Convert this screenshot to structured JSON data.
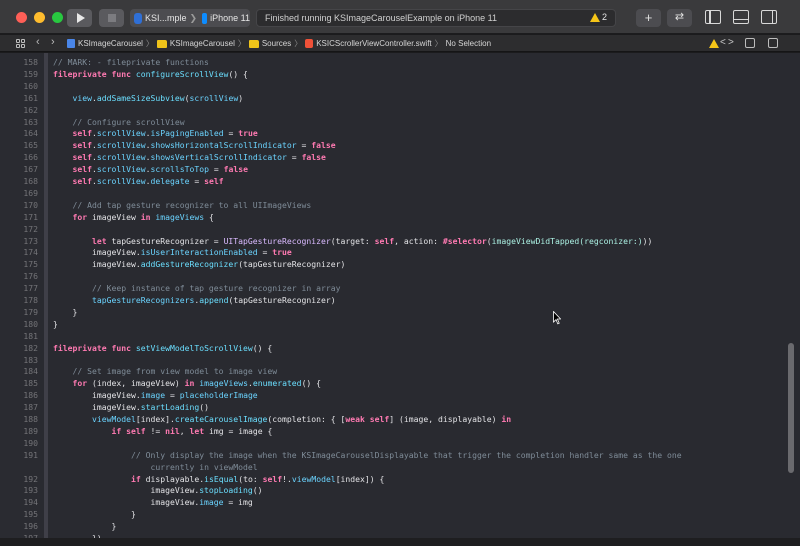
{
  "toolbar": {
    "scheme_name": "KSI...mple",
    "scheme_chevron": "❯",
    "device": "iPhone 11",
    "activity_text": "Finished running KSImageCarouselExample on iPhone 11",
    "warning_count": "2",
    "plus_label": "+",
    "swap_label": "⇄"
  },
  "jumpbar": {
    "back": "‹",
    "forward": "›",
    "crumbs": [
      "KSImageCarousel",
      "KSImageCarousel",
      "Sources",
      "KSICScrollerViewController.swift",
      "No Selection"
    ],
    "separator": "〉",
    "lt": "<",
    "gt": ">"
  },
  "colors": {
    "keyword": "#ff7ab2",
    "function": "#6bdfff",
    "type": "#dabaff",
    "comment": "#7f8c98",
    "background": "#292a30"
  },
  "editor": {
    "lines": [
      {
        "n": "158",
        "html": "<span class='cm'>// MARK: - fileprivate functions</span>"
      },
      {
        "n": "159",
        "html": "<span class='kw'>fileprivate func</span> <span class='fn'>configureScrollView</span>() {"
      },
      {
        "n": "160",
        "html": ""
      },
      {
        "n": "161",
        "html": "    <span class='prop'>view</span>.<span class='fn'>addSameSizeSubview</span>(<span class='prop'>scrollView</span>)"
      },
      {
        "n": "162",
        "html": ""
      },
      {
        "n": "163",
        "html": "    <span class='cm'>// Configure scrollView</span>"
      },
      {
        "n": "164",
        "html": "    <span class='kw'>self</span>.<span class='prop'>scrollView</span>.<span class='prop'>isPagingEnabled</span> = <span class='kw'>true</span>"
      },
      {
        "n": "165",
        "html": "    <span class='kw'>self</span>.<span class='prop'>scrollView</span>.<span class='prop'>showsHorizontalScrollIndicator</span> = <span class='kw'>false</span>"
      },
      {
        "n": "166",
        "html": "    <span class='kw'>self</span>.<span class='prop'>scrollView</span>.<span class='prop'>showsVerticalScrollIndicator</span> = <span class='kw'>false</span>"
      },
      {
        "n": "167",
        "html": "    <span class='kw'>self</span>.<span class='prop'>scrollView</span>.<span class='prop'>scrollsToTop</span> = <span class='kw'>false</span>"
      },
      {
        "n": "168",
        "html": "    <span class='kw'>self</span>.<span class='prop'>scrollView</span>.<span class='prop'>delegate</span> = <span class='kw'>self</span>"
      },
      {
        "n": "169",
        "html": ""
      },
      {
        "n": "170",
        "html": "    <span class='cm'>// Add tap gesture recognizer to all UIImageViews</span>"
      },
      {
        "n": "171",
        "html": "    <span class='kw'>for</span> imageView <span class='kw'>in</span> <span class='prop'>imageViews</span> {"
      },
      {
        "n": "172",
        "html": ""
      },
      {
        "n": "173",
        "html": "        <span class='kw'>let</span> tapGestureRecognizer = <span class='ty'>UITapGestureRecognizer</span>(target: <span class='kw'>self</span>, action: <span class='kw'>#selector</span>(<span class='ph'>imageViewDidTapped(regconizer:)</span>))"
      },
      {
        "n": "174",
        "html": "        imageView.<span class='prop'>isUserInteractionEnabled</span> = <span class='kw'>true</span>"
      },
      {
        "n": "175",
        "html": "        imageView.<span class='fn'>addGestureRecognizer</span>(tapGestureRecognizer)"
      },
      {
        "n": "176",
        "html": ""
      },
      {
        "n": "177",
        "html": "        <span class='cm'>// Keep instance of tap gesture recognizer in array</span>"
      },
      {
        "n": "178",
        "html": "        <span class='prop'>tapGestureRecognizers</span>.<span class='fn'>append</span>(tapGestureRecognizer)"
      },
      {
        "n": "179",
        "html": "    }"
      },
      {
        "n": "180",
        "html": "}"
      },
      {
        "n": "181",
        "html": ""
      },
      {
        "n": "182",
        "html": "<span class='kw'>fileprivate func</span> <span class='fn'>setViewModelToScrollView</span>() {"
      },
      {
        "n": "183",
        "html": ""
      },
      {
        "n": "184",
        "html": "    <span class='cm'>// Set image from view model to image view</span>"
      },
      {
        "n": "185",
        "html": "    <span class='kw'>for</span> (index, imageView) <span class='kw'>in</span> <span class='prop'>imageViews</span>.<span class='fn'>enumerated</span>() {"
      },
      {
        "n": "186",
        "html": "        imageView.<span class='prop'>image</span> = <span class='prop'>placeholderImage</span>"
      },
      {
        "n": "187",
        "html": "        imageView.<span class='fn'>startLoading</span>()"
      },
      {
        "n": "188",
        "html": "        <span class='prop'>viewModel</span>[index].<span class='fn'>createCarouselImage</span>(completion: { [<span class='kw'>weak self</span>] (image, displayable) <span class='kw'>in</span>"
      },
      {
        "n": "189",
        "html": "            <span class='kw'>if self</span> != <span class='kw'>nil</span>, <span class='kw'>let</span> img = image {"
      },
      {
        "n": "190",
        "html": ""
      },
      {
        "n": "191",
        "html": "                <span class='cm'>// Only display the image when the KSImageCarouselDisplayable that trigger the completion handler same as the one</span>"
      },
      {
        "n": "",
        "html": "                    <span class='cm'>currently in viewModel</span>"
      },
      {
        "n": "192",
        "html": "                <span class='kw'>if</span> displayable.<span class='fn'>isEqual</span>(to: <span class='kw'>self</span>!.<span class='prop'>viewModel</span>[index]) {"
      },
      {
        "n": "193",
        "html": "                    imageView.<span class='fn'>stopLoading</span>()"
      },
      {
        "n": "194",
        "html": "                    imageView.<span class='prop'>image</span> = img"
      },
      {
        "n": "195",
        "html": "                }"
      },
      {
        "n": "196",
        "html": "            }"
      },
      {
        "n": "197",
        "html": "        })"
      }
    ]
  }
}
